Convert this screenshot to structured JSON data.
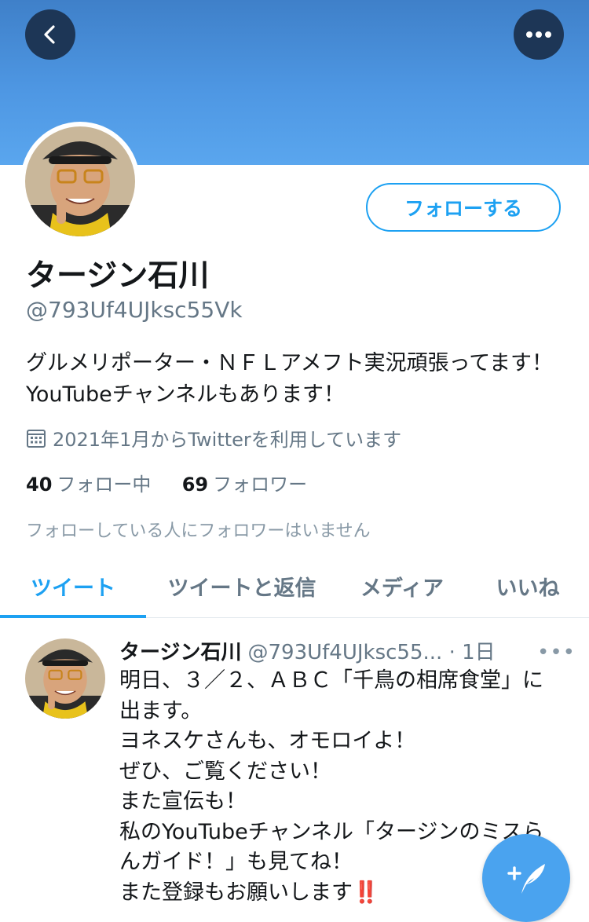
{
  "profile": {
    "name": "タージン石川",
    "handle": "@793Uf4UJksc55Vk",
    "bio": "グルメリポーター・ＮＦＬアメフト実況頑張ってます！YouTubeチャンネルもあります！",
    "joined": "2021年1月からTwitterを利用しています",
    "following_count": "40",
    "following_label": "フォロー中",
    "followers_count": "69",
    "followers_label": "フォロワー",
    "mutual_note": "フォローしている人にフォロワーはいません",
    "follow_button": "フォローする"
  },
  "tabs": [
    {
      "label": "ツイート",
      "active": true
    },
    {
      "label": "ツイートと返信",
      "active": false
    },
    {
      "label": "メディア",
      "active": false
    },
    {
      "label": "いいね",
      "active": false
    }
  ],
  "tweet": {
    "name": "タージン石川",
    "handle": "@793Uf4UJksc55...",
    "time": "· 1日",
    "lines": [
      "明日、３／２、ＡＢＣ「千鳥の相席食堂」に",
      "出ます。",
      "ヨネスケさんも、オモロイよ！",
      "ぜひ、ご覧ください！",
      "また宣伝も！",
      "私のYouTubeチャンネル「タージンのミスら",
      "んガイド！」も見てね！",
      "また登録もお願いします‼️"
    ]
  },
  "colors": {
    "accent": "#1da1f2",
    "banner": "#4e97e3",
    "secondary_text": "#657786"
  },
  "icons": [
    "back-arrow-icon",
    "more-horizontal-icon",
    "calendar-icon",
    "compose-tweet-icon"
  ]
}
